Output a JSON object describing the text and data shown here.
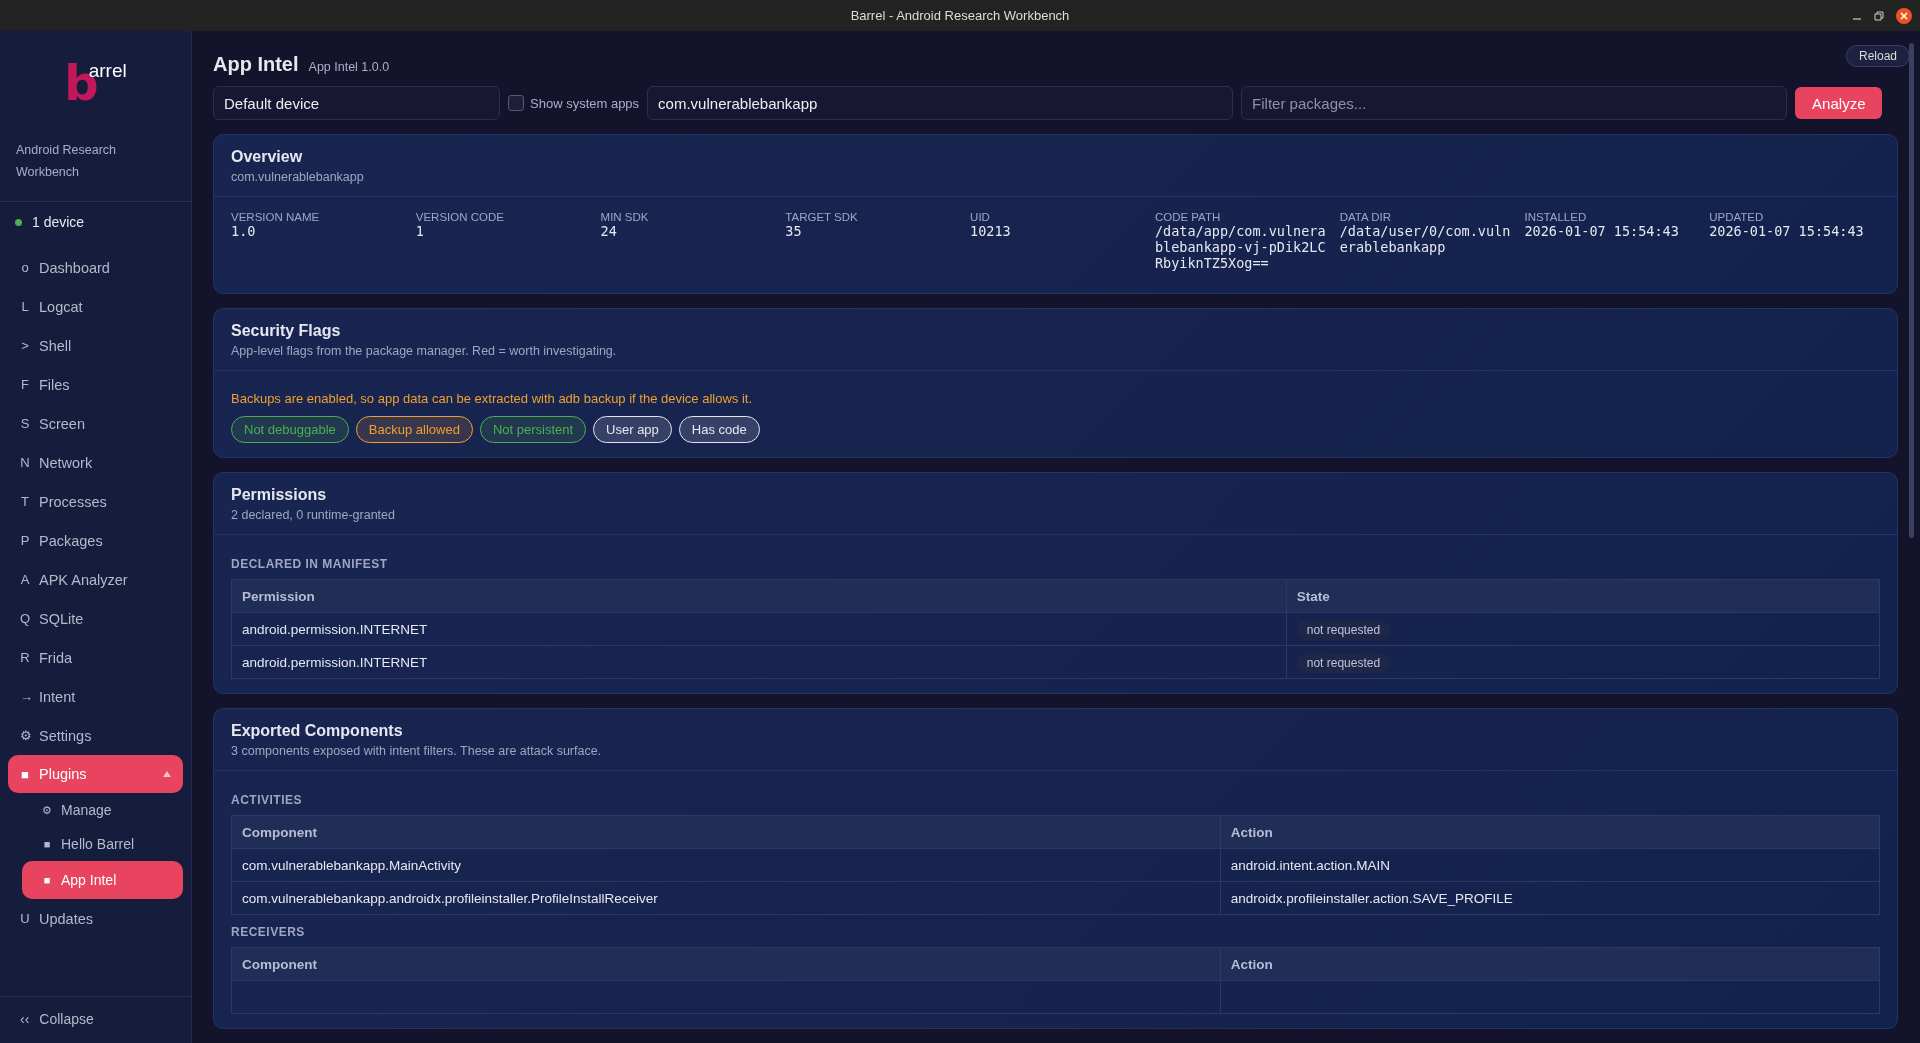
{
  "window": {
    "title": "Barrel - Android Research Workbench"
  },
  "sidebar": {
    "logo": {
      "initial": "b",
      "rest": "arrel"
    },
    "subtitle": "Android Research Workbench",
    "device": {
      "label": "1 device",
      "connected": true
    },
    "items": [
      {
        "glyph": "o",
        "label": "Dashboard",
        "selected": false
      },
      {
        "glyph": "L",
        "label": "Logcat",
        "selected": false
      },
      {
        "glyph": ">",
        "label": "Shell",
        "selected": false
      },
      {
        "glyph": "F",
        "label": "Files",
        "selected": false
      },
      {
        "glyph": "S",
        "label": "Screen",
        "selected": false
      },
      {
        "glyph": "N",
        "label": "Network",
        "selected": false
      },
      {
        "glyph": "T",
        "label": "Processes",
        "selected": false
      },
      {
        "glyph": "P",
        "label": "Packages",
        "selected": false
      },
      {
        "glyph": "A",
        "label": "APK Analyzer",
        "selected": false
      },
      {
        "glyph": "Q",
        "label": "SQLite",
        "selected": false
      },
      {
        "glyph": "R",
        "label": "Frida",
        "selected": false
      },
      {
        "glyph": "→",
        "label": "Intent",
        "selected": false
      },
      {
        "glyph": "⚙",
        "label": "Settings",
        "selected": false
      },
      {
        "glyph": "■",
        "label": "Plugins",
        "selected": true,
        "expanded": true,
        "children": [
          {
            "glyph": "⚙",
            "label": "Manage",
            "selected": false
          },
          {
            "glyph": "■",
            "label": "Hello Barrel",
            "selected": false
          },
          {
            "glyph": "■",
            "label": "App Intel",
            "selected": true
          }
        ]
      },
      {
        "glyph": "U",
        "label": "Updates",
        "selected": false
      }
    ],
    "collapse": {
      "glyph": "‹‹",
      "label": "Collapse"
    }
  },
  "header": {
    "title": "App Intel",
    "version": "App Intel 1.0.0",
    "reload": "Reload"
  },
  "toolbar": {
    "device": "Default device",
    "system_apps": {
      "label": "Show system apps",
      "checked": false
    },
    "package": "com.vulnerablebankapp",
    "filter": {
      "placeholder": "Filter packages..."
    },
    "analyze": "Analyze"
  },
  "overview": {
    "title": "Overview",
    "subtitle": "com.vulnerablebankapp",
    "fields": [
      {
        "label": "VERSION NAME",
        "value": "1.0"
      },
      {
        "label": "VERSION CODE",
        "value": "1"
      },
      {
        "label": "MIN SDK",
        "value": "24"
      },
      {
        "label": "TARGET SDK",
        "value": "35"
      },
      {
        "label": "UID",
        "value": "10213"
      },
      {
        "label": "CODE PATH",
        "value": "/data/app/com.vulnerablebankapp-vj-pDik2LCRbyiknTZ5Xog=="
      },
      {
        "label": "DATA DIR",
        "value": "/data/user/0/com.vulnerablebankapp"
      },
      {
        "label": "INSTALLED",
        "value": "2026-01-07 15:54:43"
      },
      {
        "label": "UPDATED",
        "value": "2026-01-07 15:54:43"
      }
    ]
  },
  "security_flags": {
    "title": "Security Flags",
    "subtitle": "App-level flags from the package manager. Red = worth investigating.",
    "warning": "Backups are enabled, so app data can be extracted with adb backup if the device allows it.",
    "flags": [
      {
        "label": "Not debuggable",
        "color": "#4caf50"
      },
      {
        "label": "Backup allowed",
        "color": "#f0a030"
      },
      {
        "label": "Not persistent",
        "color": "#4caf50"
      },
      {
        "label": "User app",
        "color": "#e6e8f0"
      },
      {
        "label": "Has code",
        "color": "#e6e8f0"
      }
    ]
  },
  "permissions": {
    "title": "Permissions",
    "subtitle": "2 declared, 0 runtime-granted",
    "section": "DECLARED IN MANIFEST",
    "columns": [
      "Permission",
      "State"
    ],
    "rows": [
      [
        "android.permission.INTERNET",
        "not requested"
      ],
      [
        "android.permission.INTERNET",
        "not requested"
      ]
    ]
  },
  "exported_components": {
    "title": "Exported Components",
    "subtitle": "3 components exposed with intent filters. These are attack surface.",
    "sections": [
      {
        "label": "ACTIVITIES",
        "columns": [
          "Component",
          "Action"
        ],
        "rows": [
          [
            "com.vulnerablebankapp.MainActivity",
            "android.intent.action.MAIN"
          ],
          [
            "com.vulnerablebankapp.androidx.profileinstaller.ProfileInstallReceiver",
            "androidx.profileinstaller.action.SAVE_PROFILE"
          ]
        ]
      },
      {
        "label": "RECEIVERS",
        "columns": [
          "Component",
          "Action"
        ]
      }
    ]
  }
}
